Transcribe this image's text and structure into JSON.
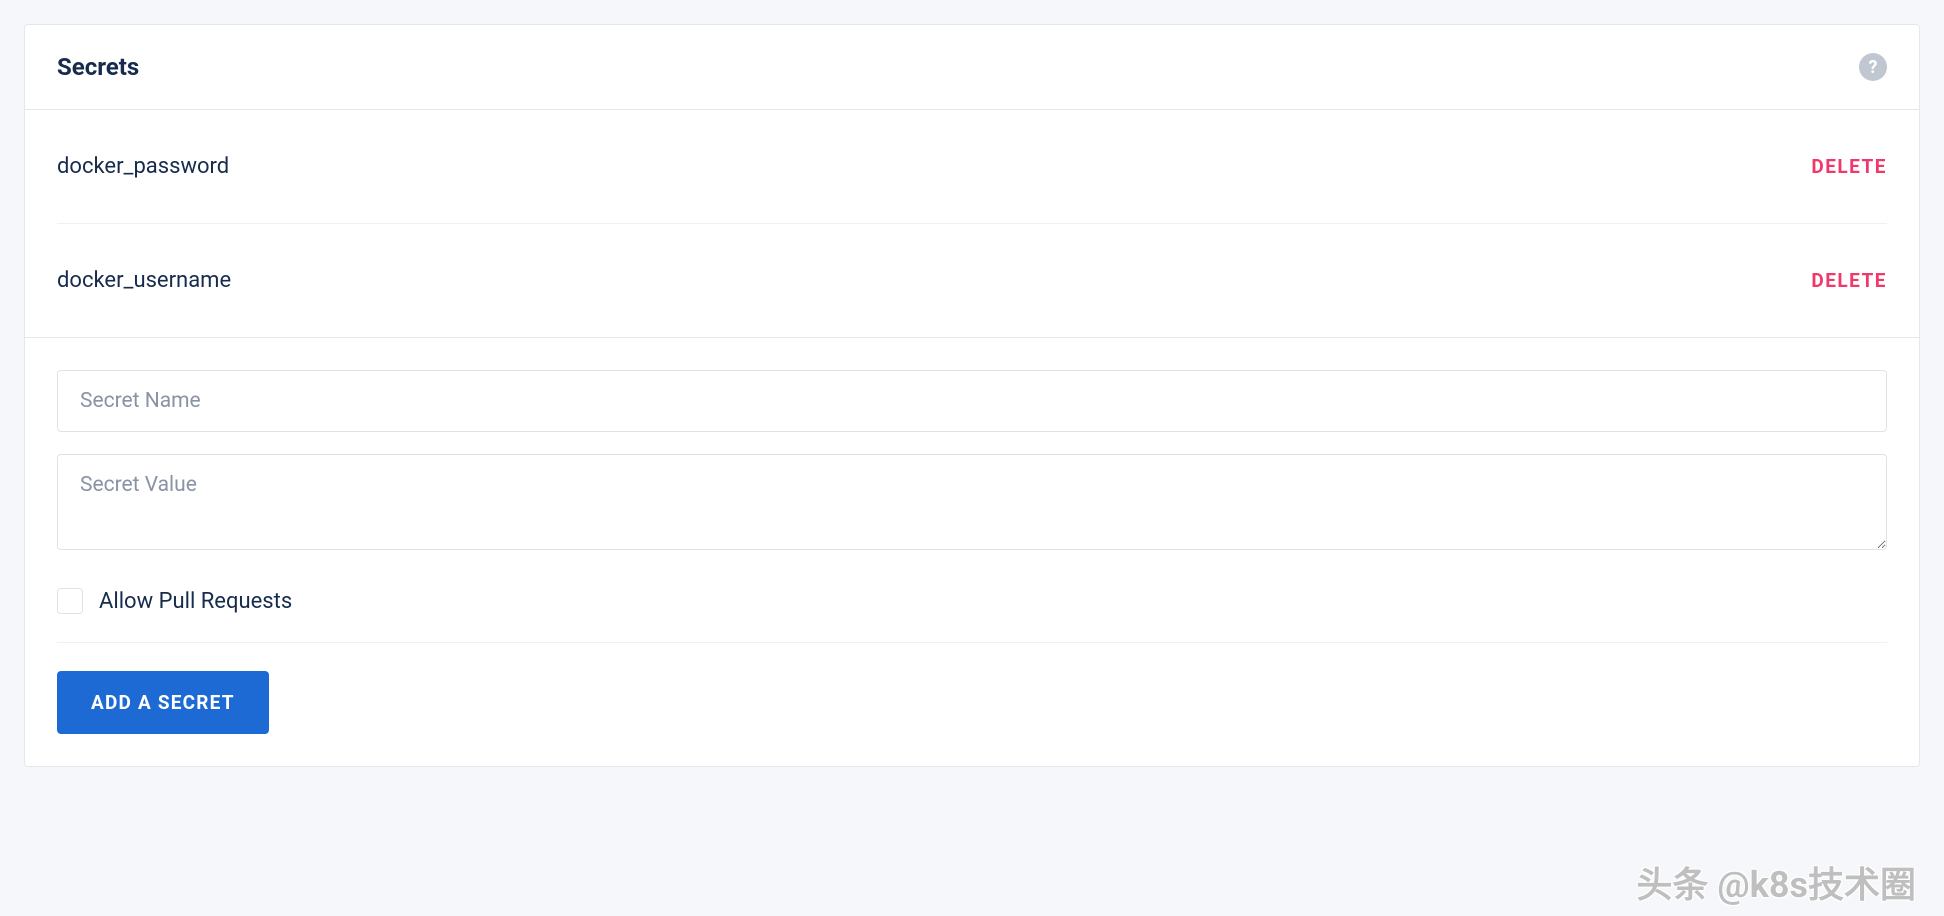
{
  "header": {
    "title": "Secrets"
  },
  "secrets": [
    {
      "name": "docker_password",
      "delete_label": "DELETE"
    },
    {
      "name": "docker_username",
      "delete_label": "DELETE"
    }
  ],
  "form": {
    "name_placeholder": "Secret Name",
    "value_placeholder": "Secret Value",
    "allow_pr_label": "Allow Pull Requests",
    "add_button_label": "ADD A SECRET"
  },
  "watermark": "头条 @k8s技术圈"
}
